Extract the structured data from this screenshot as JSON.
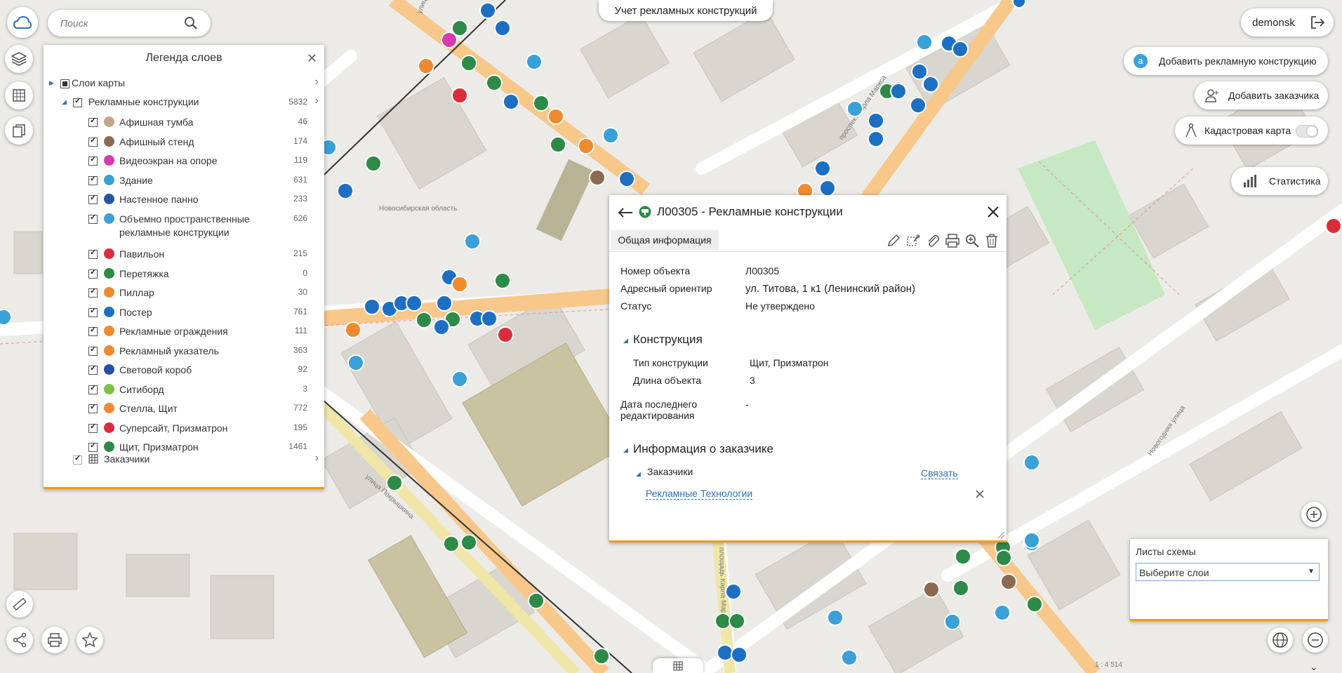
{
  "app": {
    "title": "Учет рекламных конструкций",
    "search_placeholder": "Поиск",
    "user": "demonsk"
  },
  "actions": {
    "add_construction": "Добавить рекламную конструкцию",
    "add_customer": "Добавить заказчика",
    "cadastral_map": "Кадастровая карта",
    "statistics": "Статистика"
  },
  "legend": {
    "title": "Легенда слоев",
    "map_layers": "Слои карты",
    "group": {
      "label": "Рекламные конструкции",
      "count": "5832"
    },
    "items": [
      {
        "label": "Афишная тумба",
        "count": "46",
        "color": "#c8a487"
      },
      {
        "label": "Афишный стенд",
        "count": "174",
        "color": "#8b6a50"
      },
      {
        "label": "Видеоэкран на опоре",
        "count": "119",
        "color": "#d63ab1"
      },
      {
        "label": "Здание",
        "count": "631",
        "color": "#3aa0d8"
      },
      {
        "label": "Настенное панно",
        "count": "233",
        "color": "#2453a6"
      },
      {
        "label": "Объемно пространственные рекламные конструкции",
        "count": "626",
        "color": "#3aa0d8"
      },
      {
        "label": "Павильон",
        "count": "215",
        "color": "#d92e3a"
      },
      {
        "label": "Перетяжка",
        "count": "0",
        "color": "#2d8a47"
      },
      {
        "label": "Пиллар",
        "count": "30",
        "color": "#f08a2e"
      },
      {
        "label": "Постер",
        "count": "761",
        "color": "#1d6fc2"
      },
      {
        "label": "Рекламные ограждения",
        "count": "111",
        "color": "#f08a2e"
      },
      {
        "label": "Рекламный указатель",
        "count": "363",
        "color": "#f08a2e"
      },
      {
        "label": "Световой короб",
        "count": "92",
        "color": "#2453a6"
      },
      {
        "label": "Ситиборд",
        "count": "3",
        "color": "#7cc242"
      },
      {
        "label": "Стелла, Щит",
        "count": "772",
        "color": "#f08a2e"
      },
      {
        "label": "Суперсайт, Призматрон",
        "count": "195",
        "color": "#d92e3a"
      },
      {
        "label": "Щит, Призматрон",
        "count": "1461",
        "color": "#2d8a47"
      }
    ],
    "customers": "Заказчики"
  },
  "info": {
    "title": "Л00305 - Рекламные конструкции",
    "tab": "Общая информация",
    "fields": [
      {
        "key": "Номер объекта",
        "value": "Л00305"
      },
      {
        "key": "Адресный ориентир",
        "value": "ул. Титова, 1 к1 (Ленинский район)"
      },
      {
        "key": "Статус",
        "value": "Не утверждено"
      }
    ],
    "construction_section": "Конструкция",
    "construction_fields": [
      {
        "key": "Тип конструкции",
        "value": "Щит, Призматрон"
      },
      {
        "key": "Длина объекта",
        "value": "3"
      }
    ],
    "last_edit_key": "Дата последнего редактирования",
    "last_edit_value": "-",
    "customer_section": "Информация о заказчике",
    "customers_sub": "Заказчики",
    "link_label": "Связать",
    "customer_name": "Рекламные Технологии"
  },
  "sheets": {
    "title": "Листы схемы",
    "placeholder": "Выберите слои"
  },
  "map": {
    "region_label": "Новосибирская область",
    "scale": "1 : 4 514",
    "streets": [
      "улица Ватутина",
      "проспект Карла Маркса",
      "улица Покрышкина",
      "площадь Карла Маркса",
      "Новогодняя улица",
      "улица Ватутина"
    ]
  }
}
